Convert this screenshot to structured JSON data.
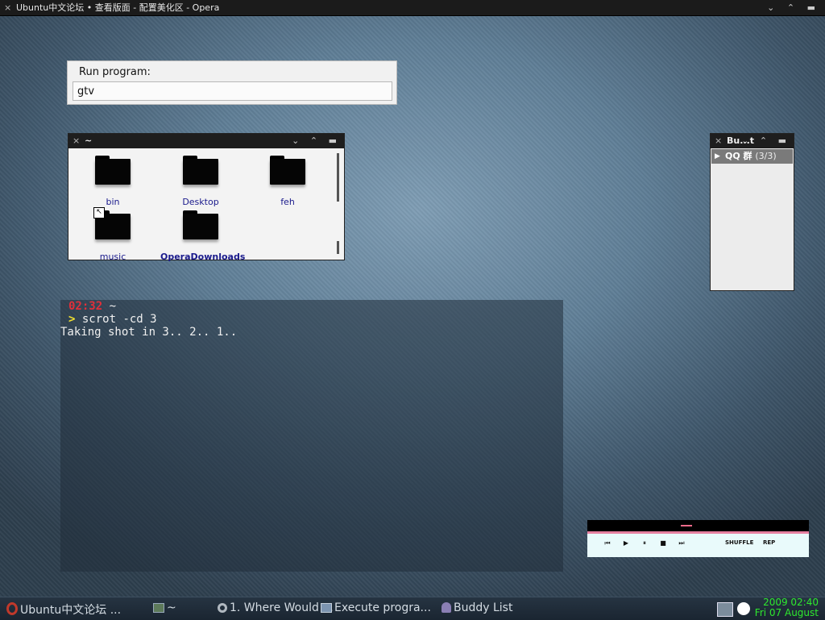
{
  "top_window": {
    "title": "Ubuntu中文论坛 • 查看版面 - 配置美化区 - Opera",
    "close_glyph": "×",
    "controls": "⌄ ⌃ ▬"
  },
  "run_dialog": {
    "label": "Run program:",
    "value": "gtv"
  },
  "file_manager": {
    "title": "~",
    "folders": [
      {
        "name": "bin"
      },
      {
        "name": "Desktop"
      },
      {
        "name": "feh"
      },
      {
        "name": "music"
      },
      {
        "name": "OperaDownloads"
      }
    ]
  },
  "buddy_list": {
    "title": "Bu...t",
    "group": {
      "name": "QQ 群",
      "count": "(3/3)"
    }
  },
  "terminal": {
    "time": "02:32",
    "cwd": "~",
    "prompt": ">",
    "command": "scrot -cd 3",
    "output": "Taking shot in 3.. 2.. 1.."
  },
  "player": {
    "shuffle_label": "SHUFFLE",
    "repeat_label": "REP"
  },
  "taskbar": {
    "tasks": [
      {
        "label": "Ubuntu中文论坛 ..."
      },
      {
        "label": "~"
      },
      {
        "label": "1. Where Would ..."
      },
      {
        "label": "Execute progra..."
      },
      {
        "label": "Buddy List"
      }
    ],
    "clock_date": "2009 02:40",
    "clock_day": "Fri 07 August"
  },
  "colors": {
    "terminal_time": "#e0303a",
    "terminal_prompt": "#f0e030",
    "clock": "#2ee82e",
    "player_accent": "#e77fa0"
  }
}
